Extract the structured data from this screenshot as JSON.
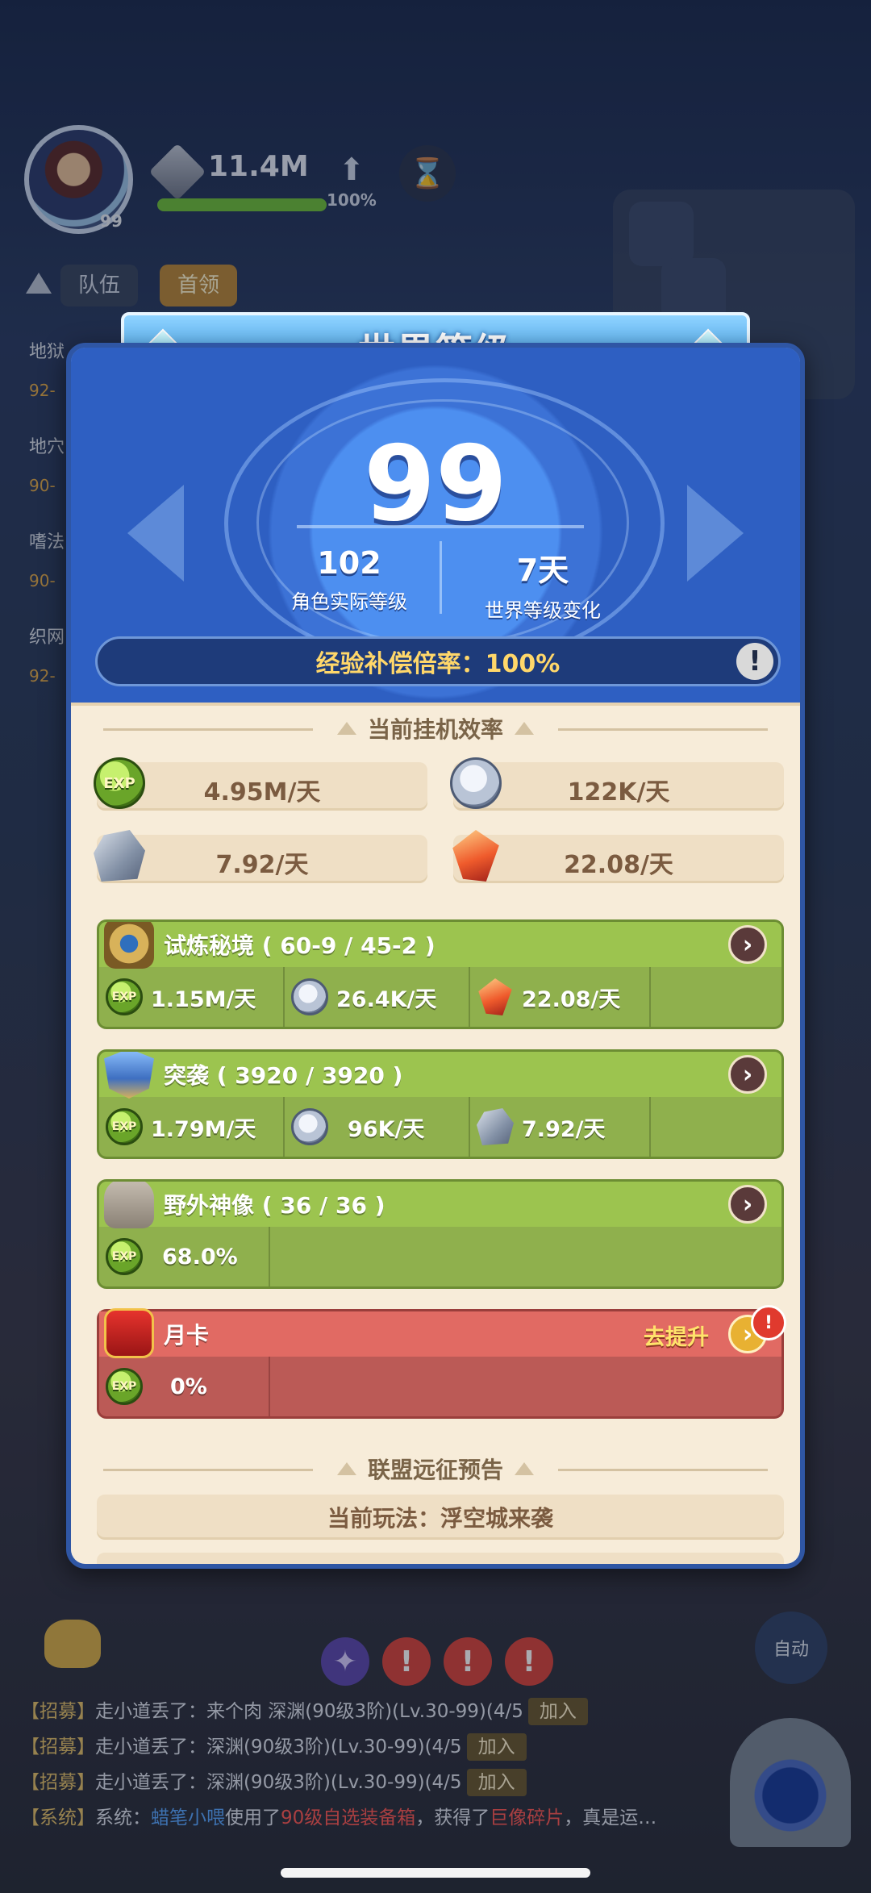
{
  "hud": {
    "player_level": "99",
    "power": "11.4M",
    "power_progress_pct": "100%",
    "power_progress_fraction": 1.0,
    "tabs": [
      "队伍",
      "首领"
    ],
    "auto_label": "自动",
    "side_items": [
      {
        "name": "地狱",
        "value": "92-"
      },
      {
        "name": "地穴",
        "value": "90-"
      },
      {
        "name": "嗜法",
        "value": "90-"
      },
      {
        "name": "织网",
        "value": "92-"
      }
    ]
  },
  "dialog": {
    "title": "世界等级",
    "world_level": "99",
    "stats": [
      {
        "value": "102",
        "label": "角色实际等级"
      },
      {
        "value": "7天",
        "label": "世界等级变化"
      }
    ],
    "exp_compensation": "经验补偿倍率：100%",
    "idle_section_title": "当前挂机效率",
    "idle_rates": [
      {
        "icon": "exp-icon",
        "value": "4.95M/天"
      },
      {
        "icon": "coin-icon",
        "value": "122K/天"
      },
      {
        "icon": "stone-icon",
        "value": "7.92/天"
      },
      {
        "icon": "crystal-icon",
        "value": "22.08/天"
      }
    ],
    "cards": [
      {
        "title": "试炼秘境 ( 60-9 / 45-2 )",
        "icon": "trial-icon",
        "items": [
          {
            "icon": "exp-icon",
            "value": "1.15M/天"
          },
          {
            "icon": "coin-icon",
            "value": "26.4K/天"
          },
          {
            "icon": "crystal-icon",
            "value": "22.08/天"
          }
        ]
      },
      {
        "title": "突袭 ( 3920 / 3920 )",
        "icon": "raid-icon",
        "items": [
          {
            "icon": "exp-icon",
            "value": "1.79M/天"
          },
          {
            "icon": "coin-icon",
            "value": "96K/天"
          },
          {
            "icon": "stone-icon",
            "value": "7.92/天"
          }
        ]
      },
      {
        "title": "野外神像 ( 36 / 36 )",
        "icon": "statue-icon",
        "items": [
          {
            "icon": "exp-icon",
            "value": "68.0%"
          }
        ]
      }
    ],
    "monthly_card": {
      "title": "月卡",
      "upgrade_label": "去提升",
      "alert": "!",
      "items": [
        {
          "icon": "exp-icon",
          "value": "0%"
        }
      ]
    },
    "alliance_section_title": "联盟远征预告",
    "current_mode": "当前玩法：浮空城来袭"
  },
  "chat": [
    {
      "tag": "【招募】",
      "text": "走小道丢了：来个肉 深渊(90级3阶)(Lv.30-99)(4/5",
      "join": "加入"
    },
    {
      "tag": "【招募】",
      "text": "走小道丢了：深渊(90级3阶)(Lv.30-99)(4/5",
      "join": "加入"
    },
    {
      "tag": "【招募】",
      "text": "走小道丢了：深渊(90级3阶)(Lv.30-99)(4/5",
      "join": "加入"
    },
    {
      "tag": "【系统】",
      "prefix": "系统：",
      "player": "蜡笔小喂",
      "mid": "使用了",
      "item": "90级自选装备箱",
      "mid2": "，获得了",
      "reward": "巨像碎片",
      "suffix": "，真是运…"
    }
  ]
}
